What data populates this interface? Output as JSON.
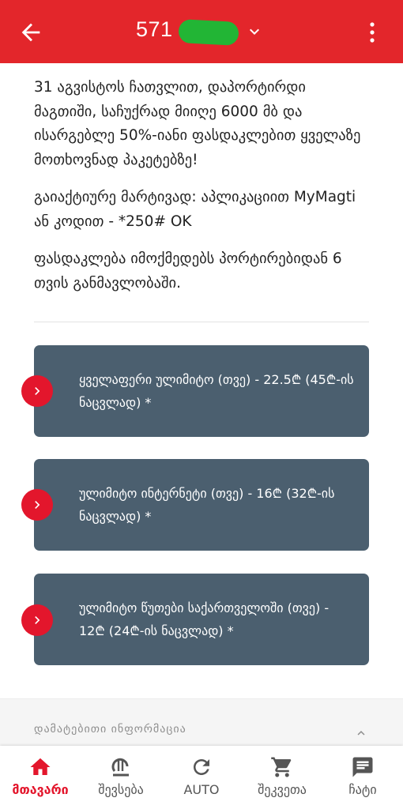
{
  "header": {
    "title": "571",
    "colors": {
      "header_bg": "#e3262b",
      "redacted_blob": "#22b535"
    }
  },
  "content": {
    "paragraphs": [
      "31 აგვისტოს ჩათვლით, დაპორტირდი მაგთიში, საჩუქრად მიიღე 6000 მბ და ისარგებლე 50%-იანი ფასდაკლებით ყველაზე მოთხოვნად პაკეტებზე!",
      "გაიაქტიურე მარტივად: აპლიკაციით MyMagti ან კოდით - *250# OK",
      "ფასდაკლება იმოქმედებს პორტირებიდან 6 თვის განმავლობაში."
    ]
  },
  "offers": [
    {
      "label": "ყველაფერი ულიმიტო (თვე) - 22.5₾ (45₾-ის ნაცვლად) *"
    },
    {
      "label": "ულიმიტო ინტერნეტი (თვე) - 16₾ (32₾-ის ნაცვლად) *"
    },
    {
      "label": "ულიმიტო წუთები საქართველოში (თვე) - 12₾ (24₾-ის ნაცვლად) *"
    }
  ],
  "more_info": {
    "label": "დამატებითი ინფორმაცია"
  },
  "nav": {
    "items": [
      {
        "label": "მთავარი",
        "icon": "home-icon"
      },
      {
        "label": "შევსება",
        "icon": "lari-icon"
      },
      {
        "label": "AUTO",
        "icon": "refresh-icon"
      },
      {
        "label": "შეკვეთა",
        "icon": "cart-icon"
      },
      {
        "label": "ჩატი",
        "icon": "chat-icon"
      }
    ]
  },
  "colors": {
    "accent": "#e3162c",
    "card_bg": "#4b5f6f"
  }
}
